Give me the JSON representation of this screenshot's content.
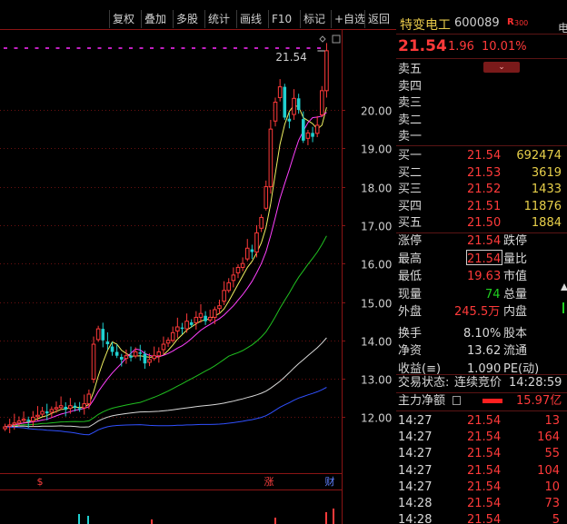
{
  "toolbar": {
    "buttons": [
      "复权",
      "叠加",
      "多股",
      "统计",
      "画线",
      "F10",
      "标记",
      "+自选",
      "返回"
    ]
  },
  "chart": {
    "y_ticks": [
      "20.00",
      "19.00",
      "18.00",
      "17.00",
      "16.00",
      "15.00",
      "14.00",
      "13.00",
      "12.00"
    ],
    "max_label": "21.54",
    "markers": [
      "$",
      "涨",
      "财"
    ]
  },
  "chart_data": {
    "type": "candlestick",
    "y_axis_ticks": [
      20.0,
      19.0,
      18.0,
      17.0,
      16.0,
      15.0,
      14.0,
      13.0,
      12.0
    ],
    "highest_price_marker": 21.54,
    "close_series_approx": [
      11.75,
      11.8,
      11.85,
      11.9,
      11.95,
      11.9,
      12.0,
      12.05,
      12.15,
      12.1,
      12.2,
      12.25,
      12.3,
      12.2,
      12.3,
      12.25,
      12.2,
      12.35,
      12.6,
      13.9,
      14.3,
      14.0,
      13.9,
      13.7,
      13.6,
      13.5,
      13.6,
      13.55,
      13.7,
      13.65,
      13.4,
      13.5,
      13.6,
      13.7,
      13.9,
      14.0,
      14.2,
      14.35,
      14.3,
      14.5,
      14.4,
      14.6,
      14.7,
      14.5,
      14.6,
      14.8,
      14.9,
      15.3,
      15.5,
      15.7,
      15.9,
      16.0,
      16.4,
      16.3,
      16.8,
      17.2,
      18.0,
      19.5,
      20.2,
      20.6,
      19.8,
      19.7,
      20.3,
      20.0,
      19.2,
      19.4,
      19.3,
      19.6,
      20.5,
      21.54
    ],
    "ma_lines": [
      "yellow",
      "magenta",
      "green",
      "white",
      "blue"
    ]
  },
  "quote": {
    "name": "特变电工",
    "code": "600089",
    "r_badge": "R",
    "r_num": "300",
    "cut": "电",
    "price": "21.54",
    "change": "1.96",
    "pct": "10.01%"
  },
  "asks": [
    {
      "label": "卖五"
    },
    {
      "label": "卖四"
    },
    {
      "label": "卖三"
    },
    {
      "label": "卖二"
    },
    {
      "label": "卖一"
    }
  ],
  "bids": [
    {
      "label": "买一",
      "price": "21.54",
      "vol": "692474"
    },
    {
      "label": "买二",
      "price": "21.53",
      "vol": "3619"
    },
    {
      "label": "买三",
      "price": "21.52",
      "vol": "1433"
    },
    {
      "label": "买四",
      "price": "21.51",
      "vol": "11876"
    },
    {
      "label": "买五",
      "price": "21.50",
      "vol": "1884"
    }
  ],
  "stats": {
    "zt_label": "涨停",
    "zt": "21.54",
    "dt_label": "跌停",
    "zg_label": "最高",
    "zg": "21.54",
    "lb_label": "量比",
    "zd_label": "最低",
    "zd": "19.63",
    "sz_label": "市值",
    "xl_label": "现量",
    "xl": "74",
    "zl_label": "总量",
    "wp_label": "外盘",
    "wp": "245.5万",
    "np_label": "内盘",
    "hs_label": "换手",
    "hs": "8.10%",
    "gb_label": "股本",
    "jz_label": "净资",
    "jz": "13.62",
    "lt_label": "流通",
    "sy_label": "收益(≡)",
    "sy": "1.090",
    "pe_label": "PE(动)"
  },
  "trade_status": {
    "label": "交易状态:",
    "value": "连续竞价",
    "time": "14:28:59"
  },
  "main_flow": {
    "label": "主力净额",
    "value": "15.97亿"
  },
  "ticks": [
    {
      "time": "14:27",
      "price": "21.54",
      "vol": "13"
    },
    {
      "time": "14:27",
      "price": "21.54",
      "vol": "164"
    },
    {
      "time": "14:27",
      "price": "21.54",
      "vol": "55"
    },
    {
      "time": "14:27",
      "price": "21.54",
      "vol": "104"
    },
    {
      "time": "14:27",
      "price": "21.54",
      "vol": "10"
    },
    {
      "time": "14:28",
      "price": "21.54",
      "vol": "73"
    },
    {
      "time": "14:28",
      "price": "21.54",
      "vol": "5"
    }
  ]
}
